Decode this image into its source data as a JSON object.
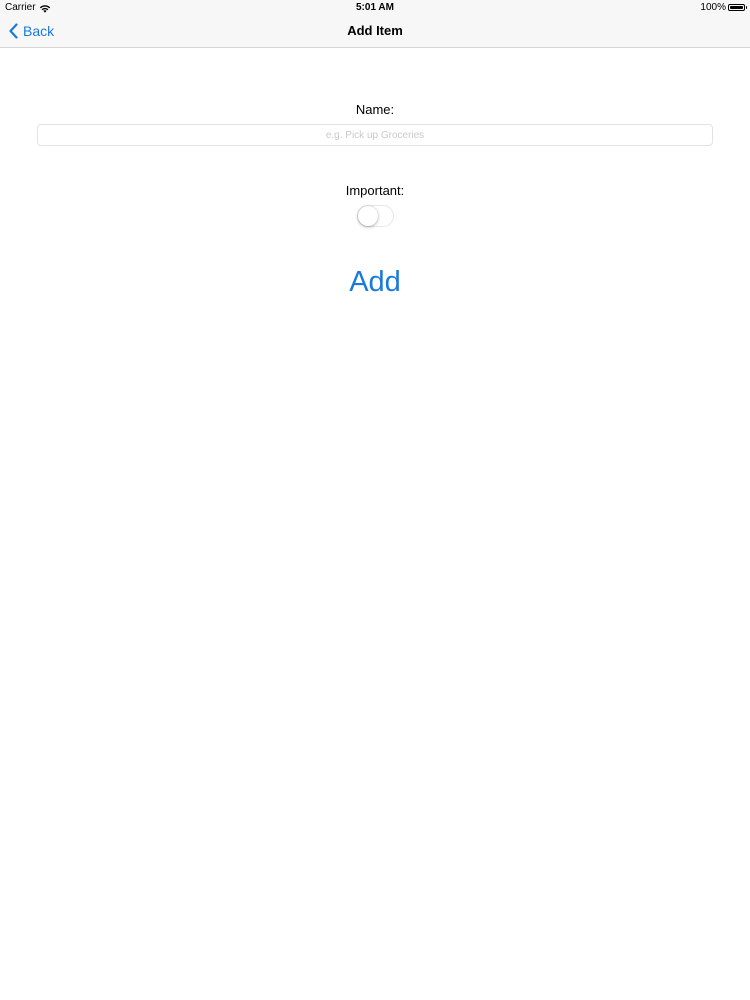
{
  "status_bar": {
    "carrier": "Carrier",
    "time": "5:01 AM",
    "battery": "100%"
  },
  "nav_bar": {
    "back_label": "Back",
    "title": "Add Item"
  },
  "form": {
    "name_label": "Name:",
    "name_value": "",
    "name_placeholder": "e.g. Pick up Groceries",
    "important_label": "Important:",
    "important_on": false,
    "add_label": "Add"
  },
  "colors": {
    "accent": "#1a7ad9",
    "bar_background": "#f7f7f8"
  },
  "icons": {
    "wifi": "wifi-icon",
    "battery": "battery-icon",
    "back": "chevron-left-icon"
  }
}
